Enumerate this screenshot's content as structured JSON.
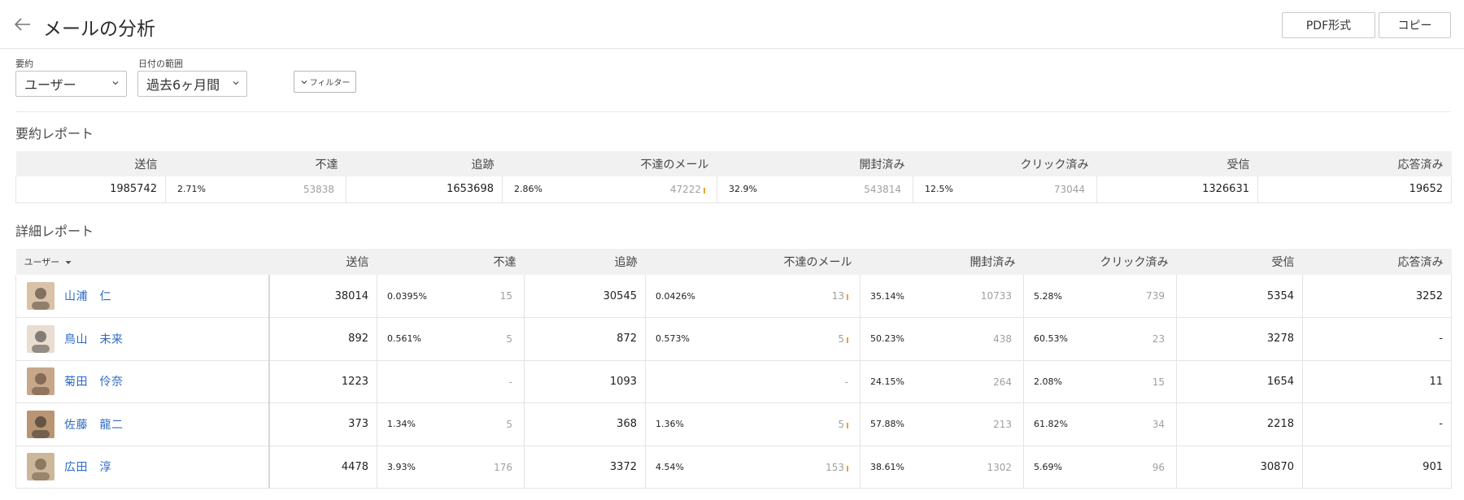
{
  "header": {
    "title": "メールの分析",
    "pdf_button": "PDF形式",
    "copy_button": "コピー"
  },
  "filters": {
    "summary_label": "要約",
    "summary_value": "ユーザー",
    "date_label": "日付の範囲",
    "date_value": "過去6ヶ月間",
    "filter_button": "フィルター"
  },
  "summary_report": {
    "title": "要約レポート",
    "headers": [
      "送信",
      "不達",
      "追跡",
      "不達のメール",
      "開封済み",
      "クリック済み",
      "受信",
      "応答済み"
    ],
    "row": {
      "sent": "1985742",
      "bounce_pct": "2.71%",
      "bounce": "53838",
      "tracked": "1653698",
      "bounced_mail_pct": "2.86%",
      "bounced_mail": "47222",
      "opened_pct": "32.9%",
      "opened": "543814",
      "clicked_pct": "12.5%",
      "clicked": "73044",
      "received": "1326631",
      "replied": "19652"
    }
  },
  "detail_report": {
    "title": "詳細レポート",
    "user_header": "ユーザー",
    "headers": [
      "送信",
      "不達",
      "追跡",
      "不達のメール",
      "開封済み",
      "クリック済み",
      "受信",
      "応答済み"
    ],
    "rows": [
      {
        "name": "山浦　仁",
        "sent": "38014",
        "bounce_pct": "0.0395%",
        "bounce": "15",
        "tracked": "30545",
        "bm_pct": "0.0426%",
        "bm": "13",
        "open_pct": "35.14%",
        "open": "10733",
        "click_pct": "5.28%",
        "click": "739",
        "received": "5354",
        "replied": "3252"
      },
      {
        "name": "鳥山　未来",
        "sent": "892",
        "bounce_pct": "0.561%",
        "bounce": "5",
        "tracked": "872",
        "bm_pct": "0.573%",
        "bm": "5",
        "open_pct": "50.23%",
        "open": "438",
        "click_pct": "60.53%",
        "click": "23",
        "received": "3278",
        "replied": "-"
      },
      {
        "name": "菊田　伶奈",
        "sent": "1223",
        "bounce_pct": "",
        "bounce": "-",
        "tracked": "1093",
        "bm_pct": "",
        "bm": "-",
        "open_pct": "24.15%",
        "open": "264",
        "click_pct": "2.08%",
        "click": "15",
        "received": "1654",
        "replied": "11"
      },
      {
        "name": "佐藤　龍二",
        "sent": "373",
        "bounce_pct": "1.34%",
        "bounce": "5",
        "tracked": "368",
        "bm_pct": "1.36%",
        "bm": "5",
        "open_pct": "57.88%",
        "open": "213",
        "click_pct": "61.82%",
        "click": "34",
        "received": "2218",
        "replied": "-"
      },
      {
        "name": "広田　淳",
        "sent": "4478",
        "bounce_pct": "3.93%",
        "bounce": "176",
        "tracked": "3372",
        "bm_pct": "4.54%",
        "bm": "153",
        "open_pct": "38.61%",
        "open": "1302",
        "click_pct": "5.69%",
        "click": "96",
        "received": "30870",
        "replied": "901"
      }
    ]
  },
  "colors": {
    "link": "#2d6bc4",
    "accent_tick": "#f0a030",
    "header_bg": "#f1f1f1"
  }
}
